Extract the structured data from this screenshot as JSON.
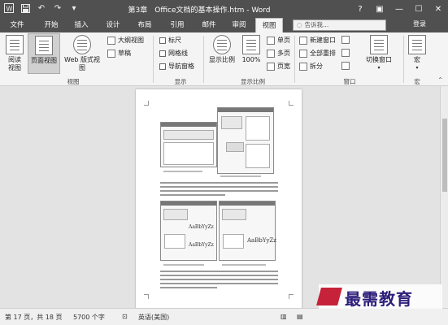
{
  "title": "第3章　Office文档的基本操作.htm - Word",
  "window_controls": {
    "help": "?",
    "ribbon_options": "▣",
    "minimize": "—",
    "restore": "☐",
    "close": "✕"
  },
  "quick_access": {
    "save_icon": "floppy-disk",
    "undo": "↶",
    "redo": "↷"
  },
  "tabs": [
    "文件",
    "开始",
    "插入",
    "设计",
    "布局",
    "引用",
    "邮件",
    "审阅",
    "视图"
  ],
  "active_tab": "视图",
  "search": {
    "placeholder": "告诉我..."
  },
  "login": "登录",
  "ribbon": {
    "views": {
      "read_mode": "阅读\n视图",
      "print_layout": "页面视图",
      "web_layout": "Web 版式视图",
      "outline": "大纲视图",
      "draft": "草稿",
      "group_label": "视图"
    },
    "show": {
      "ruler": "标尺",
      "gridlines": "网格线",
      "nav_pane": "导航窗格",
      "group_label": "显示"
    },
    "zoom": {
      "zoom": "显示比例",
      "hundred": "100%",
      "one_page": "单页",
      "multi_page": "多页",
      "page_width": "页宽",
      "group_label": "显示比例"
    },
    "window": {
      "new_window": "新建窗口",
      "arrange_all": "全部重排",
      "split": "拆分",
      "switch_windows": "切换窗口",
      "group_label": "窗口"
    },
    "macros": {
      "macros": "宏",
      "group_label": "宏"
    }
  },
  "document": {
    "font_preview_1": "AaBbYyZz",
    "font_preview_2": "AaBbYyZz",
    "font_preview_3": "AaBbYyZz"
  },
  "status": {
    "page": "第 17 页，共 18 页",
    "words": "5700 个字",
    "language": "英语(美国)"
  },
  "watermark": "最需教育"
}
